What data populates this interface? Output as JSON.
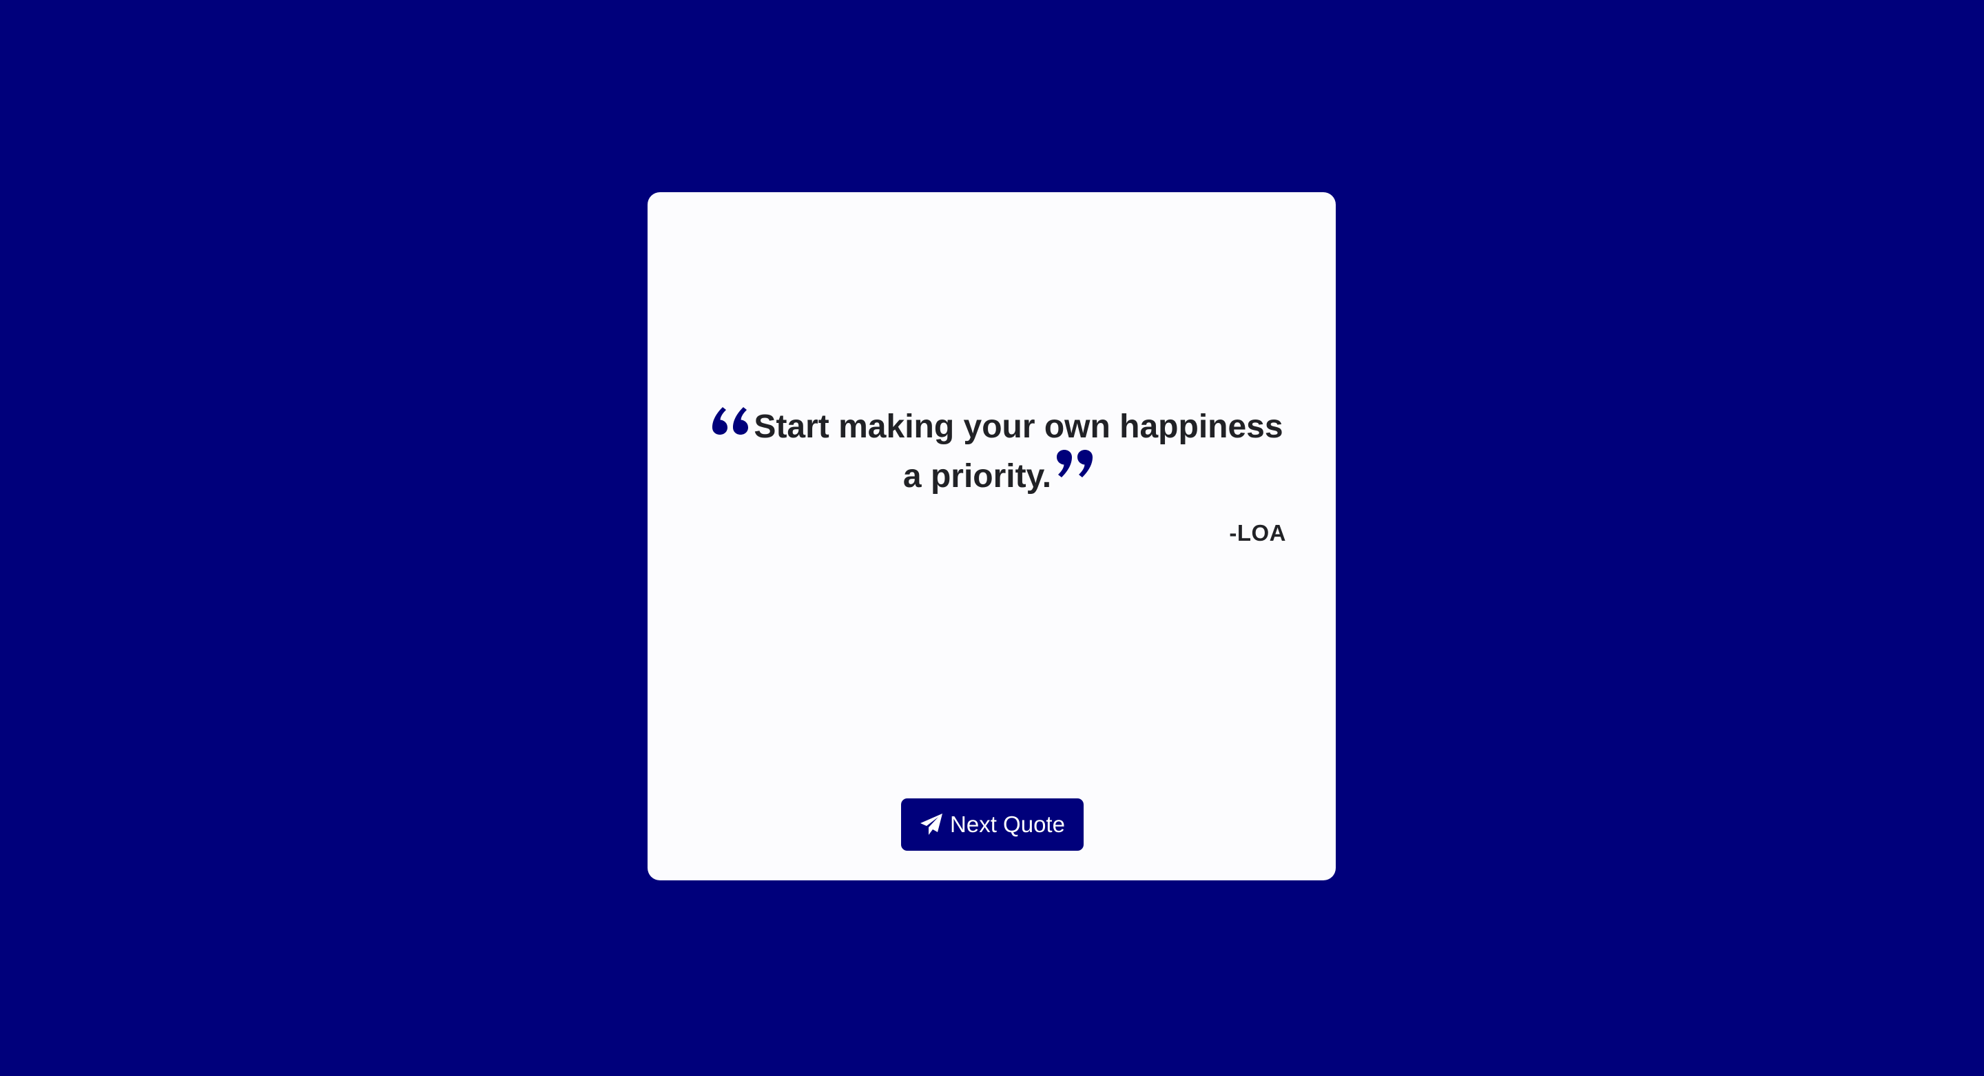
{
  "theme": {
    "background": "#00007b",
    "card": "#fcfcfe",
    "accent": "#00007b",
    "text": "#212226"
  },
  "quote": {
    "open_icon": "quote-left-icon",
    "text": "Start making your own happiness a priority.",
    "close_icon": "quote-right-icon",
    "author": "-LOA"
  },
  "actions": {
    "next_icon": "paper-plane-icon",
    "next_label": "Next Quote"
  }
}
